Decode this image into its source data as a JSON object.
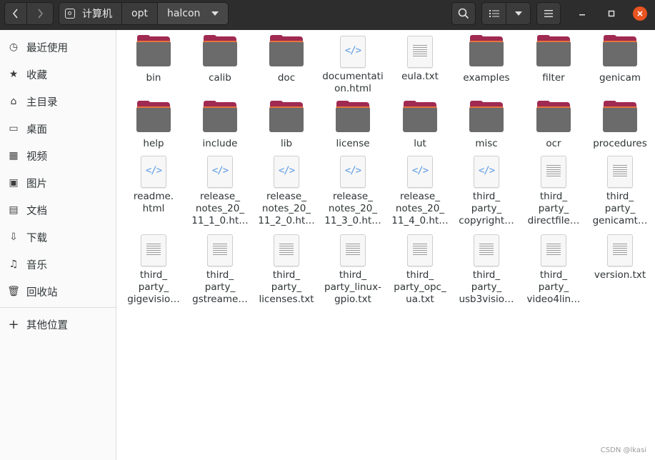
{
  "header": {
    "crumbs": [
      "计算机",
      "opt",
      "halcon"
    ]
  },
  "sidebar": {
    "items": [
      {
        "label": "最近使用",
        "icon": "clock-icon",
        "glyph": "◷"
      },
      {
        "label": "收藏",
        "icon": "star-icon",
        "glyph": "★"
      },
      {
        "label": "主目录",
        "icon": "home-icon",
        "glyph": "⌂"
      },
      {
        "label": "桌面",
        "icon": "desktop-icon",
        "glyph": "▭"
      },
      {
        "label": "视频",
        "icon": "video-icon",
        "glyph": "▦"
      },
      {
        "label": "图片",
        "icon": "image-icon",
        "glyph": "▣"
      },
      {
        "label": "文档",
        "icon": "document-icon",
        "glyph": "▤"
      },
      {
        "label": "下载",
        "icon": "download-icon",
        "glyph": "⇩"
      },
      {
        "label": "音乐",
        "icon": "music-icon",
        "glyph": "♫"
      },
      {
        "label": "回收站",
        "icon": "trash-icon",
        "glyph": "🗑"
      }
    ],
    "other": {
      "label": "其他位置",
      "icon": "plus-icon",
      "glyph": "+"
    }
  },
  "files": [
    {
      "name": "bin",
      "type": "folder"
    },
    {
      "name": "calib",
      "type": "folder"
    },
    {
      "name": "doc",
      "type": "folder"
    },
    {
      "name": "documentation.html",
      "type": "html"
    },
    {
      "name": "eula.txt",
      "type": "text"
    },
    {
      "name": "examples",
      "type": "folder"
    },
    {
      "name": "filter",
      "type": "folder"
    },
    {
      "name": "genicam",
      "type": "folder"
    },
    {
      "name": "help",
      "type": "folder"
    },
    {
      "name": "include",
      "type": "folder"
    },
    {
      "name": "lib",
      "type": "folder"
    },
    {
      "name": "license",
      "type": "folder"
    },
    {
      "name": "lut",
      "type": "folder"
    },
    {
      "name": "misc",
      "type": "folder"
    },
    {
      "name": "ocr",
      "type": "folder"
    },
    {
      "name": "procedures",
      "type": "folder"
    },
    {
      "name": "readme.\nhtml",
      "type": "html"
    },
    {
      "name": "release_\nnotes_20_\n11_1_0.ht…",
      "type": "html"
    },
    {
      "name": "release_\nnotes_20_\n11_2_0.ht…",
      "type": "html"
    },
    {
      "name": "release_\nnotes_20_\n11_3_0.ht…",
      "type": "html"
    },
    {
      "name": "release_\nnotes_20_\n11_4_0.ht…",
      "type": "html"
    },
    {
      "name": "third_\nparty_\ncopyright…",
      "type": "html"
    },
    {
      "name": "third_\nparty_\ndirectfile…",
      "type": "text"
    },
    {
      "name": "third_\nparty_\ngenicamt…",
      "type": "text"
    },
    {
      "name": "third_\nparty_\ngigevisio…",
      "type": "text"
    },
    {
      "name": "third_\nparty_\ngstreame…",
      "type": "text"
    },
    {
      "name": "third_\nparty_\nlicenses.txt",
      "type": "text"
    },
    {
      "name": "third_\nparty_linux-\ngpio.txt",
      "type": "text"
    },
    {
      "name": "third_\nparty_opc_\nua.txt",
      "type": "text"
    },
    {
      "name": "third_\nparty_\nusb3visio…",
      "type": "text"
    },
    {
      "name": "third_\nparty_\nvideo4lin…",
      "type": "text"
    },
    {
      "name": "version.txt",
      "type": "text"
    }
  ],
  "watermark": "CSDN @lkasi",
  "colors": {
    "header": "#2d2d2d",
    "folder_front": "#6b6b6b",
    "folder_back": "#a02a52",
    "close": "#e95420",
    "html_icon": "#5e9ce6"
  }
}
